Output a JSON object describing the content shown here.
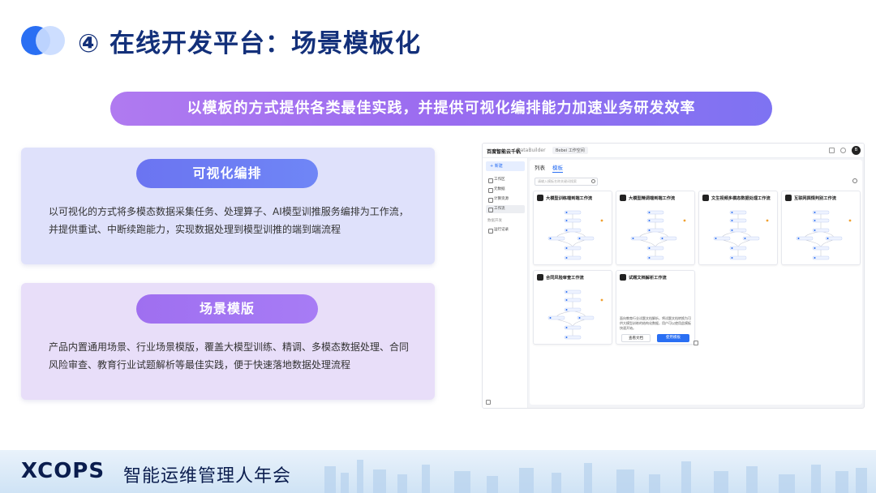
{
  "header": {
    "title": "④ 在线开发平台：场景模板化"
  },
  "banner": {
    "text": "以模板的方式提供各类最佳实践，并提供可视化编排能力加速业务研发效率"
  },
  "cards": [
    {
      "title": "可视化编排",
      "body": "以可视化的方式将多模态数据采集任务、处理算子、AI模型训推服务编排为工作流，并提供重试、中断续跑能力，实现数据处理到模型训推的端到端流程"
    },
    {
      "title": "场景模版",
      "body": "产品内置通用场景、行业场景模版，覆盖大模型训练、精调、多模态数据处理、合同风险审查、教育行业试题解析等最佳实践，便于快速落地数据处理流程"
    }
  ],
  "screenshot": {
    "brand": "百度智能云千帆",
    "brand_sub": "DataBuilder",
    "workspace": "Bebei 工作空间",
    "user_initial": "B",
    "new_button": "+ 新建",
    "nav": [
      {
        "label": "工作区"
      },
      {
        "label": "元数据"
      },
      {
        "label": "计算资源"
      },
      {
        "label": "工作流"
      }
    ],
    "nav_group": "数据开发",
    "nav_extra": "运行记录",
    "tabs": [
      "列表",
      "模板"
    ],
    "search_placeholder": "请输入模板名称关键词搜索",
    "templates": [
      {
        "name": "大模型训练端到端工作流"
      },
      {
        "name": "大模型精调端到端工作流"
      },
      {
        "name": "文生视频多模态数据处理工作流"
      },
      {
        "name": "互联网舆情判别工作流"
      },
      {
        "name": "合同风险审查工作流"
      },
      {
        "name": "试题文档解析工作流",
        "description": "面向教育行业试题文档解析，将试题文档转换为可供大模型训练的结构化数据，用户可以使用此模板快速开始。"
      }
    ],
    "view_button": "查看文档",
    "use_button": "使用模板"
  },
  "footer": {
    "brand": "XCOPS",
    "subtitle": "智能运维管理人年会"
  },
  "colors": {
    "title": "#13307a",
    "accent_blue": "#2a6ff3",
    "banner_start": "#b07af0",
    "banner_end": "#7e73f2"
  }
}
